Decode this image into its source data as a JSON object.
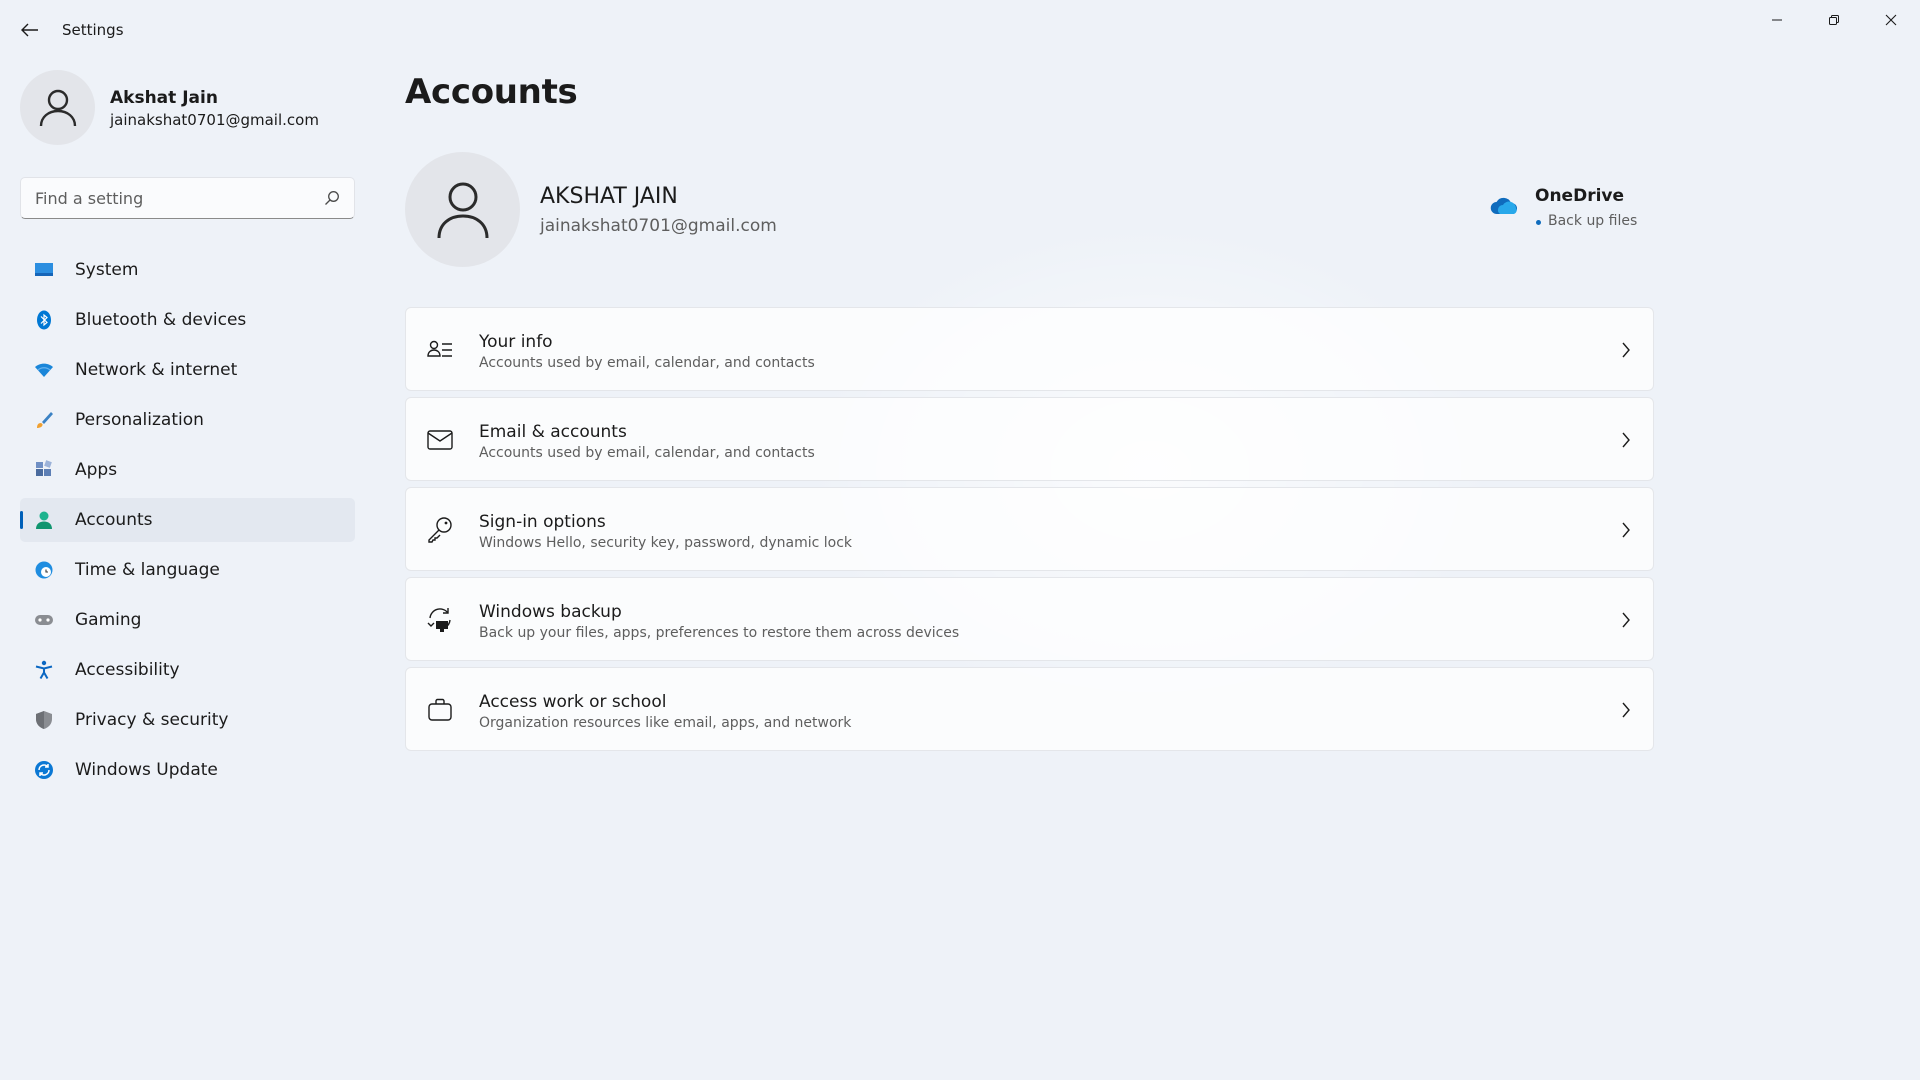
{
  "window": {
    "title": "Settings"
  },
  "profile": {
    "name": "Akshat Jain",
    "email": "jainakshat0701@gmail.com"
  },
  "search": {
    "placeholder": "Find a setting"
  },
  "sidebar": {
    "items": [
      {
        "label": "System",
        "icon": "monitor-icon",
        "color": "#0078d4"
      },
      {
        "label": "Bluetooth & devices",
        "icon": "bluetooth-icon",
        "color": "#0078d4"
      },
      {
        "label": "Network & internet",
        "icon": "wifi-icon",
        "color": "#0078d4"
      },
      {
        "label": "Personalization",
        "icon": "brush-icon",
        "color": "#e0643c"
      },
      {
        "label": "Apps",
        "icon": "apps-icon",
        "color": "#4a6b9e"
      },
      {
        "label": "Accounts",
        "icon": "person-icon",
        "color": "#1db38e",
        "active": true
      },
      {
        "label": "Time & language",
        "icon": "globe-clock-icon",
        "color": "#1f8de0"
      },
      {
        "label": "Gaming",
        "icon": "gamepad-icon",
        "color": "#7a7a7a"
      },
      {
        "label": "Accessibility",
        "icon": "accessibility-icon",
        "color": "#0a67c2"
      },
      {
        "label": "Privacy & security",
        "icon": "shield-icon",
        "color": "#8a8d92"
      },
      {
        "label": "Windows Update",
        "icon": "update-icon",
        "color": "#0b78d4"
      }
    ]
  },
  "main": {
    "title": "Accounts",
    "account": {
      "name": "AKSHAT JAIN",
      "email": "jainakshat0701@gmail.com"
    },
    "onedrive": {
      "title": "OneDrive",
      "status": "Back up files",
      "color": "#0f6cbd"
    },
    "cards": [
      {
        "title": "Your info",
        "subtitle": "Accounts used by email, calendar, and contacts",
        "icon": "person-list-icon"
      },
      {
        "title": "Email & accounts",
        "subtitle": "Accounts used by email, calendar, and contacts",
        "icon": "mail-icon"
      },
      {
        "title": "Sign-in options",
        "subtitle": "Windows Hello, security key, password, dynamic lock",
        "icon": "key-icon"
      },
      {
        "title": "Windows backup",
        "subtitle": "Back up your files, apps, preferences to restore them across devices",
        "icon": "backup-icon"
      },
      {
        "title": "Access work or school",
        "subtitle": "Organization resources like email, apps, and network",
        "icon": "briefcase-icon"
      }
    ]
  },
  "colors": {
    "accent": "#005fb8",
    "background": "#eef2f8"
  }
}
